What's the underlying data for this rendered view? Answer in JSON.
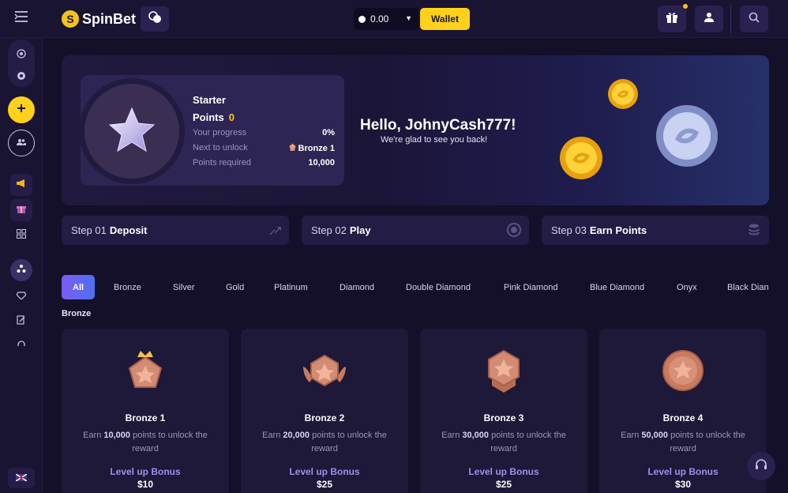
{
  "header": {
    "logo_text": "SpinBet",
    "balance": "0.00",
    "wallet_label": "Wallet"
  },
  "status": {
    "tier": "Starter",
    "points_label": "Points",
    "points_value": "0",
    "rows": [
      {
        "label": "Your progress",
        "value": "0%"
      },
      {
        "label": "Next to unlock",
        "value": "Bronze 1"
      },
      {
        "label": "Points required",
        "value": "10,000"
      }
    ]
  },
  "greeting": {
    "title": "Hello, JohnyCash777!",
    "subtitle": "We're glad to see you back!"
  },
  "steps": [
    {
      "prefix": "Step 01",
      "name": "Deposit"
    },
    {
      "prefix": "Step 02",
      "name": "Play"
    },
    {
      "prefix": "Step 03",
      "name": "Earn Points"
    }
  ],
  "tabs": [
    "All",
    "Bronze",
    "Silver",
    "Gold",
    "Platinum",
    "Diamond",
    "Double Diamond",
    "Pink Diamond",
    "Blue Diamond",
    "Onyx",
    "Black Dian"
  ],
  "active_tab": "All",
  "section_title": "Bronze",
  "levels": [
    {
      "name": "Bronze 1",
      "earn_prefix": "Earn",
      "points": "10,000",
      "earn_suffix": "points to unlock the reward",
      "bonus_label": "Level up Bonus",
      "bonus": "$10"
    },
    {
      "name": "Bronze 2",
      "earn_prefix": "Earn",
      "points": "20,000",
      "earn_suffix": "points to unlock the reward",
      "bonus_label": "Level up Bonus",
      "bonus": "$25"
    },
    {
      "name": "Bronze 3",
      "earn_prefix": "Earn",
      "points": "30,000",
      "earn_suffix": "points to unlock the reward",
      "bonus_label": "Level up Bonus",
      "bonus": "$25"
    },
    {
      "name": "Bronze 4",
      "earn_prefix": "Earn",
      "points": "50,000",
      "earn_suffix": "points to unlock the reward",
      "bonus_label": "Level up Bonus",
      "bonus": "$30"
    }
  ],
  "colors": {
    "accent_yellow": "#ffd11a",
    "points_gold": "#ffc21a",
    "tab_active": "#6c5ce7",
    "level_bonus": "#9d91e8"
  }
}
